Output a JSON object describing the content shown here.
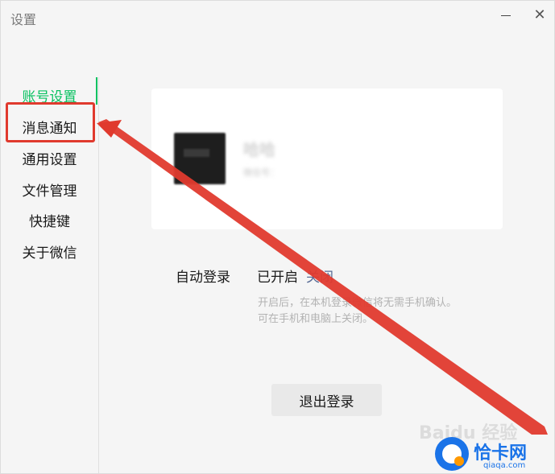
{
  "window": {
    "title": "设置",
    "minimize_label": "",
    "close_label": "✕"
  },
  "sidebar": {
    "items": [
      {
        "label": "账号设置"
      },
      {
        "label": "消息通知"
      },
      {
        "label": "通用设置"
      },
      {
        "label": "文件管理"
      },
      {
        "label": "快捷键"
      },
      {
        "label": "关于微信"
      }
    ],
    "active_index": 0,
    "highlighted_index": 1
  },
  "account": {
    "nickname": "哈哈",
    "wxid": "微信号："
  },
  "auto_login": {
    "label": "自动登录",
    "status": "已开启",
    "action": "关闭",
    "hint_line1": "开启后，在本机登录微信将无需手机确认。",
    "hint_line2": "可在手机和电脑上关闭。"
  },
  "logout_label": "退出登录",
  "watermark": {
    "brand": "恰卡网",
    "domain": "qiaqa.com",
    "baidu": "Baidu 经验"
  },
  "colors": {
    "accent": "#07c160",
    "link": "#576b95",
    "annotation": "#e03a2e"
  }
}
